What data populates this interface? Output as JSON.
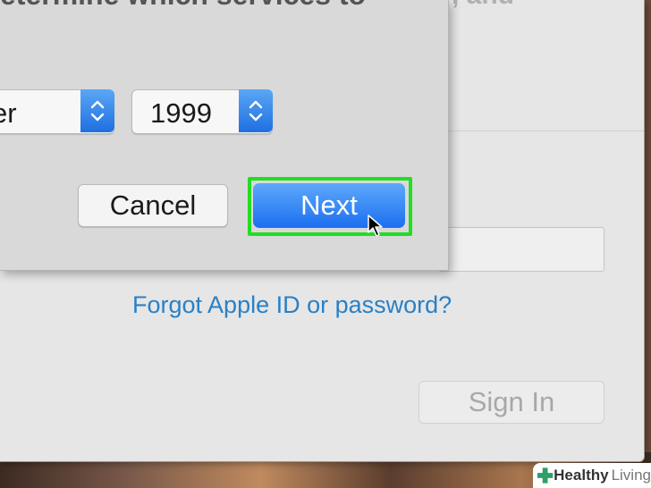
{
  "background_window": {
    "top_text": ", and",
    "forgot_link": "Forgot Apple ID or password?",
    "sign_in_label": "Sign In"
  },
  "sheet": {
    "title": "etermine which services to",
    "month_popup": {
      "value": "er",
      "icon": "chevron-updown-icon"
    },
    "year_popup": {
      "value": "1999",
      "icon": "chevron-updown-icon"
    },
    "cancel_label": "Cancel",
    "next_label": "Next"
  },
  "watermark": {
    "part1": "Healthy",
    "part2": "Living"
  },
  "colors": {
    "accent_blue": "#1f6fe0",
    "link_blue": "#2a80c4",
    "highlight_green": "#22dd22"
  }
}
